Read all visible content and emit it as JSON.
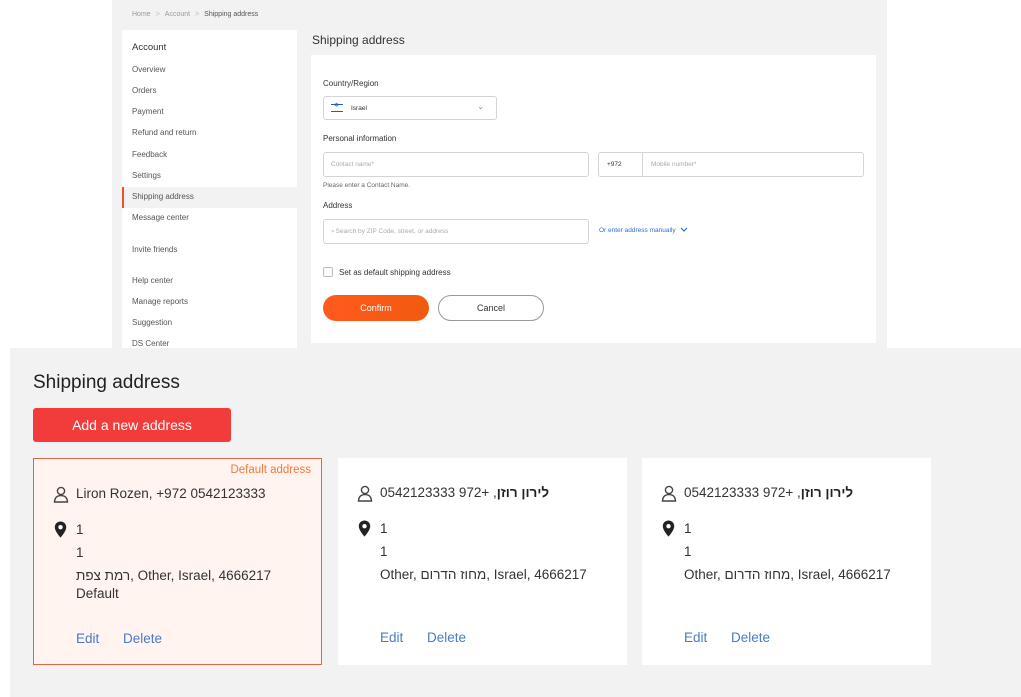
{
  "form": {
    "breadcrumb": {
      "home": "Home",
      "account": "Account",
      "current": "Shipping address"
    },
    "sidebar": {
      "heading": "Account",
      "items": [
        "Overview",
        "Orders",
        "Payment",
        "Refund and return",
        "Feedback",
        "Settings",
        "Shipping address",
        "Message center",
        "Invite friends",
        "Help center",
        "Manage reports",
        "Suggestion",
        "DS Center"
      ],
      "active": "Shipping address"
    },
    "title": "Shipping address",
    "country_label": "Country/Region",
    "country_value": "Israel",
    "personal_label": "Personal information",
    "contact_placeholder": "Contact name*",
    "phone_code": "+972",
    "mobile_placeholder": "Mobile number*",
    "contact_error": "Please enter a Contact Name.",
    "address_label": "Address",
    "address_placeholder": "Search by ZIP Code, street, or address",
    "manual_link": "Or enter address manually",
    "default_checkbox_label": "Set as default shipping address",
    "confirm_label": "Confirm",
    "cancel_label": "Cancel",
    "accent_color": "#f25a0e"
  },
  "list": {
    "title": "Shipping address",
    "add_button": "Add a new address",
    "add_button_color": "#f23c3c",
    "cards": [
      {
        "badge": "Default address",
        "name": "Liron Rozen",
        "phone": ", +972 0542123333",
        "line1": "1",
        "line2": "1",
        "line3": "רמת צפת, Other, Israel, 4666217",
        "line4": "Default",
        "edit": "Edit",
        "delete": "Delete"
      },
      {
        "name": "לירון רוזן",
        "phone": ", +972 0542123333",
        "line1": "1",
        "line2": "1",
        "line3": "Other, מחוז הדרום, Israel, 4666217",
        "edit": "Edit",
        "delete": "Delete"
      },
      {
        "name": "לירון רוזן",
        "phone": ", +972 0542123333",
        "line1": "1",
        "line2": "1",
        "line3": "Other, מחוז הדרום, Israel, 4666217",
        "edit": "Edit",
        "delete": "Delete"
      }
    ]
  }
}
